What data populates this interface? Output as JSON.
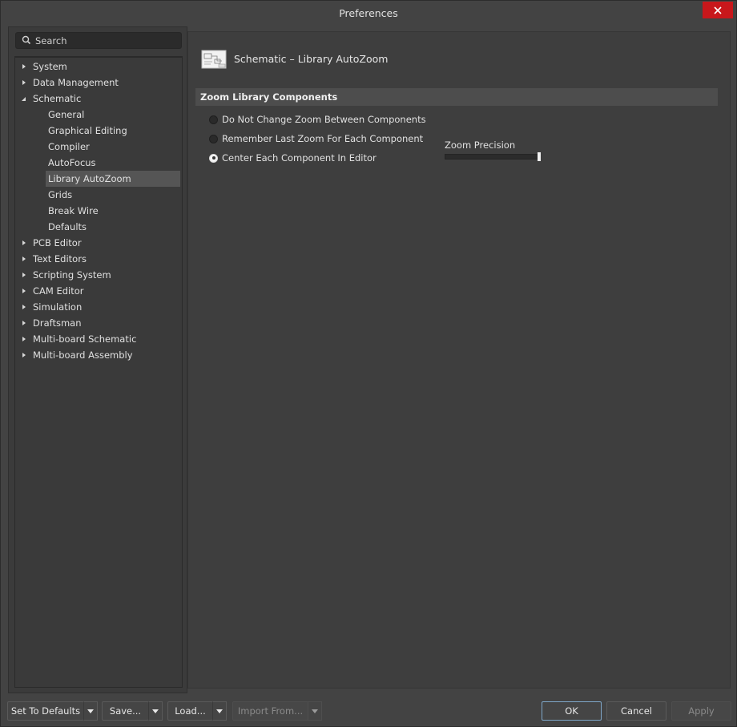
{
  "window": {
    "title": "Preferences"
  },
  "search": {
    "placeholder": "Search",
    "icon": "search-icon"
  },
  "tree": {
    "items": [
      {
        "label": "System",
        "level": 0,
        "expanded": false
      },
      {
        "label": "Data Management",
        "level": 0,
        "expanded": false
      },
      {
        "label": "Schematic",
        "level": 0,
        "expanded": true
      },
      {
        "label": "General",
        "level": 1
      },
      {
        "label": "Graphical Editing",
        "level": 1
      },
      {
        "label": "Compiler",
        "level": 1
      },
      {
        "label": "AutoFocus",
        "level": 1
      },
      {
        "label": "Library AutoZoom",
        "level": 1,
        "selected": true
      },
      {
        "label": "Grids",
        "level": 1
      },
      {
        "label": "Break Wire",
        "level": 1
      },
      {
        "label": "Defaults",
        "level": 1
      },
      {
        "label": "PCB Editor",
        "level": 0,
        "expanded": false
      },
      {
        "label": "Text Editors",
        "level": 0,
        "expanded": false
      },
      {
        "label": "Scripting System",
        "level": 0,
        "expanded": false
      },
      {
        "label": "CAM Editor",
        "level": 0,
        "expanded": false
      },
      {
        "label": "Simulation",
        "level": 0,
        "expanded": false
      },
      {
        "label": "Draftsman",
        "level": 0,
        "expanded": false
      },
      {
        "label": "Multi-board Schematic",
        "level": 0,
        "expanded": false
      },
      {
        "label": "Multi-board Assembly",
        "level": 0,
        "expanded": false
      }
    ]
  },
  "page": {
    "title": "Schematic – Library AutoZoom",
    "icon": "schematic-sheet-icon",
    "section": "Zoom Library Components",
    "options": [
      {
        "label": "Do Not Change Zoom Between Components",
        "checked": false
      },
      {
        "label": "Remember Last Zoom For Each Component",
        "checked": false
      },
      {
        "label": "Center Each Component In Editor",
        "checked": true
      }
    ],
    "zoom_precision": {
      "label": "Zoom Precision",
      "value": 1.0
    }
  },
  "buttons": {
    "set_to_defaults": "Set To Defaults",
    "save": "Save...",
    "load": "Load...",
    "import_from": "Import From...",
    "ok": "OK",
    "cancel": "Cancel",
    "apply": "Apply"
  },
  "colors": {
    "close_button": "#c8171b",
    "background": "#434343",
    "selected_item": "#555555",
    "ok_border": "#7fa7c9"
  }
}
